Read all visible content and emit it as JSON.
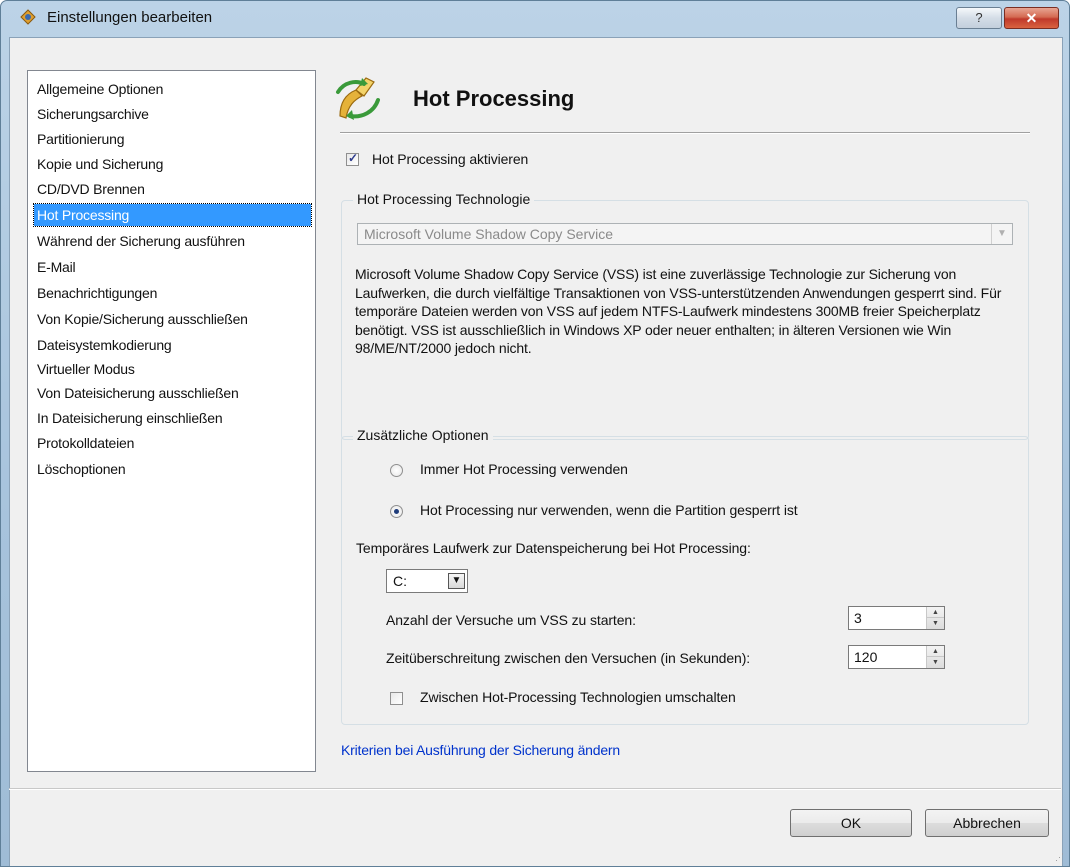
{
  "window": {
    "title": "Einstellungen bearbeiten",
    "help_label": "?",
    "close_label": "✕"
  },
  "sidebar": {
    "items": [
      {
        "label": "Allgemeine Optionen"
      },
      {
        "label": "Sicherungsarchive"
      },
      {
        "label": "Partitionierung"
      },
      {
        "label": "Kopie und Sicherung"
      },
      {
        "label": "CD/DVD Brennen"
      },
      {
        "label": "Hot Processing",
        "selected": true
      },
      {
        "label": "Während der Sicherung ausführen"
      },
      {
        "label": "E-Mail"
      },
      {
        "label": "Benachrichtigungen"
      },
      {
        "label": "Von Kopie/Sicherung ausschließen"
      },
      {
        "label": "Dateisystemkodierung"
      },
      {
        "label": "Virtueller Modus"
      },
      {
        "label": "Von Dateisicherung ausschließen"
      },
      {
        "label": "In Dateisicherung einschließen"
      },
      {
        "label": "Protokolldateien"
      },
      {
        "label": "Löschoptionen"
      }
    ]
  },
  "main": {
    "page_title": "Hot Processing",
    "enable_label": "Hot Processing aktivieren",
    "enable_checked": true,
    "technology": {
      "legend": "Hot Processing Technologie",
      "combo_value": "Microsoft Volume Shadow Copy Service",
      "description": "Microsoft Volume Shadow Copy Service (VSS) ist eine zuverlässige Technologie zur Sicherung von Laufwerken, die durch vielfältige Transaktionen von VSS-unterstützenden Anwendungen gesperrt sind. Für temporäre Dateien werden von VSS auf jedem NTFS-Laufwerk mindestens 300MB freier Speicherplatz benötigt. VSS ist ausschließlich in Windows XP oder neuer enthalten; in älteren Versionen wie Win 98/ME/NT/2000 jedoch nicht."
    },
    "options": {
      "legend": "Zusätzliche Optionen",
      "radio_always": "Immer Hot Processing verwenden",
      "radio_locked": "Hot Processing nur verwenden, wenn die Partition gesperrt ist",
      "selected_radio": "locked",
      "temp_drive_label": "Temporäres Laufwerk zur Datenspeicherung bei Hot Processing:",
      "temp_drive_value": "C:",
      "attempts_label": "Anzahl der Versuche um VSS zu starten:",
      "attempts_value": "3",
      "timeout_label": "Zeitüberschreitung zwischen den Versuchen (in Sekunden):",
      "timeout_value": "120",
      "switch_label": "Zwischen Hot-Processing Technologien umschalten",
      "switch_checked": false
    },
    "criteria_link": "Kriterien bei Ausführung der Sicherung ändern"
  },
  "footer": {
    "ok_label": "OK",
    "cancel_label": "Abbrechen"
  },
  "colors": {
    "selection": "#3399ff",
    "link": "#0033cc",
    "frame": "#a7c3dc"
  }
}
